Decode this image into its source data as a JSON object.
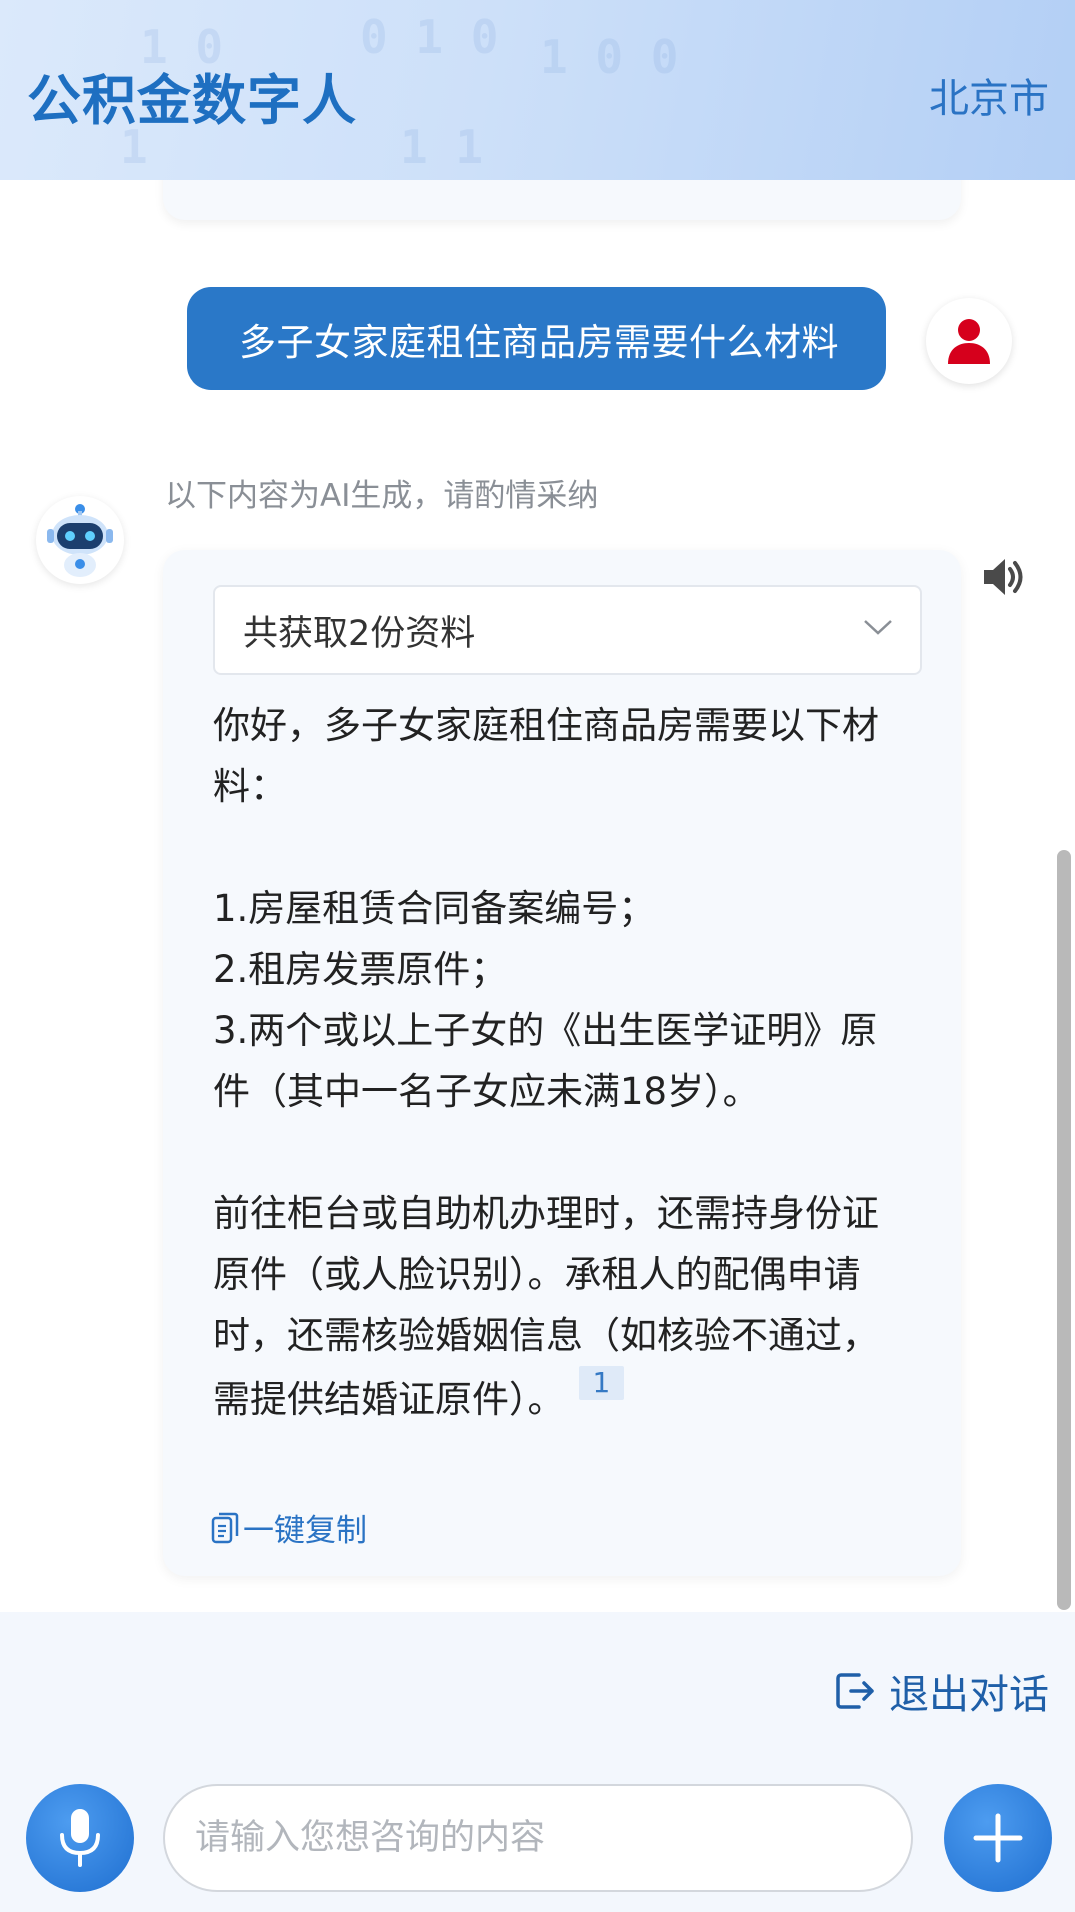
{
  "header": {
    "title": "公积金数字人",
    "city": "北京市"
  },
  "conversation": {
    "user_message": "多子女家庭租住商品房需要什么材料",
    "ai_notice": "以下内容为AI生成，请酌情采纳",
    "sources_summary": "共获取2份资料",
    "answer_paragraphs": [
      "你好，多子女家庭租住商品房需要以下材料：",
      "",
      "1.房屋租赁合同备案编号；",
      "2.租房发票原件；",
      "3.两个或以上子女的《出生医学证明》原件（其中一名子女应未满18岁）。",
      "",
      "前往柜台或自助机办理时，还需持身份证原件（或人脸识别）。承租人的配偶申请时，还需核验婚姻信息（如核验不通过，需提供结婚证原件）。"
    ],
    "citation_number": "1",
    "copy_label": "一键复制"
  },
  "bottom": {
    "exit_label": "退出对话",
    "input_placeholder": "请输入您想咨询的内容"
  },
  "colors": {
    "brand_blue": "#2a78c8",
    "title_blue": "#1e6fc1",
    "user_avatar_red": "#d6001c"
  }
}
